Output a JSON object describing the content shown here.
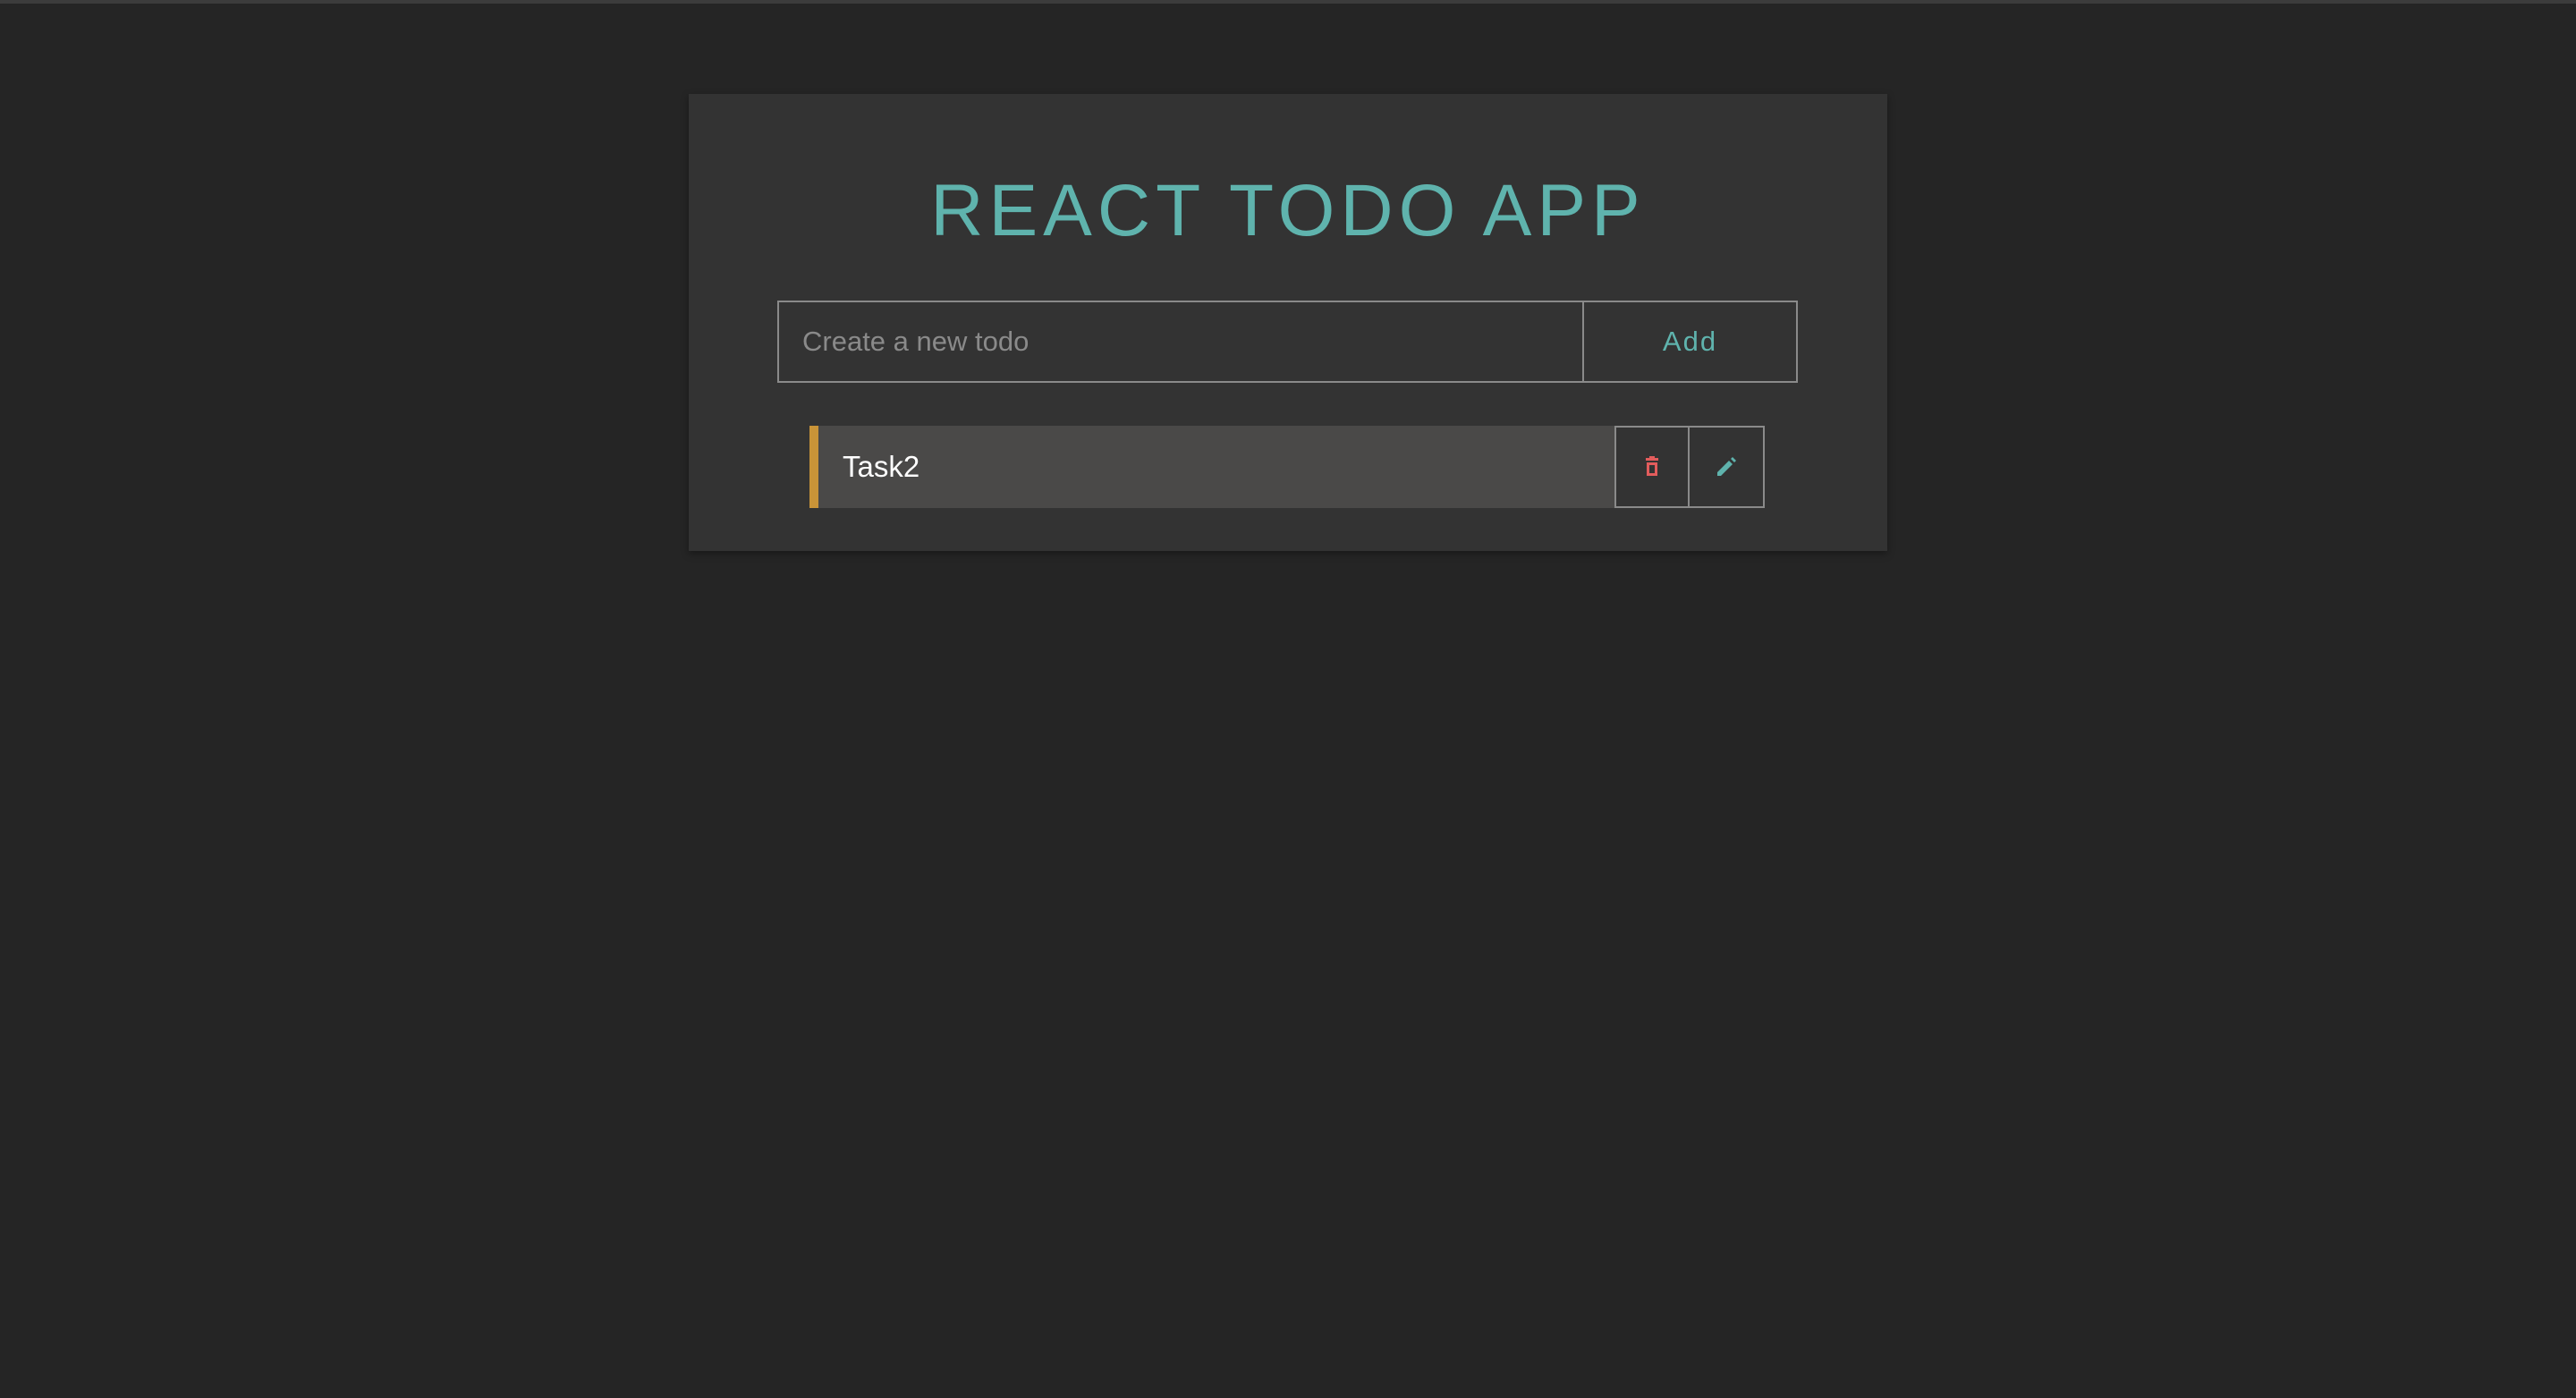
{
  "app": {
    "title": "REACT TODO APP"
  },
  "form": {
    "placeholder": "Create a new todo",
    "value": "",
    "add_label": "Add"
  },
  "todos": [
    {
      "text": "Task2",
      "accent_color": "#c99438"
    }
  ],
  "icons": {
    "delete": "trash-icon",
    "edit": "pencil-icon"
  },
  "colors": {
    "background": "#252525",
    "card": "#333333",
    "accent": "#5fb3ad",
    "delete": "#e25c5c",
    "todo_bar": "#c99438"
  }
}
